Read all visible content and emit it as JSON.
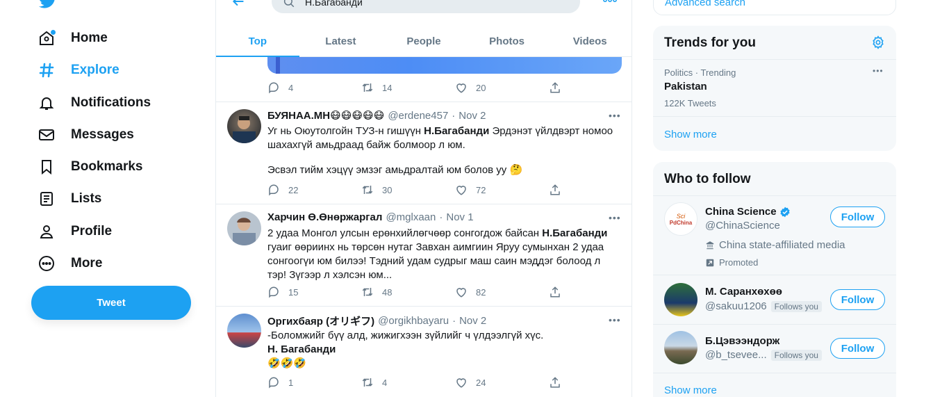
{
  "nav": {
    "items": [
      {
        "label": "Home",
        "icon": "home-icon"
      },
      {
        "label": "Explore",
        "icon": "hashtag-icon"
      },
      {
        "label": "Notifications",
        "icon": "bell-icon"
      },
      {
        "label": "Messages",
        "icon": "envelope-icon"
      },
      {
        "label": "Bookmarks",
        "icon": "bookmark-icon"
      },
      {
        "label": "Lists",
        "icon": "list-icon"
      },
      {
        "label": "Profile",
        "icon": "person-icon"
      },
      {
        "label": "More",
        "icon": "more-circle-icon"
      }
    ],
    "tweet_label": "Tweet"
  },
  "search": {
    "query": "Н.Багабанди"
  },
  "tabs": [
    "Top",
    "Latest",
    "People",
    "Photos",
    "Videos"
  ],
  "first_tweet_actions": {
    "replies": "4",
    "retweets": "14",
    "likes": "20"
  },
  "tweets": [
    {
      "name": "БУЯНАА.МН😷😷😷😷😷",
      "handle": "@erdene457",
      "date": "Nov 2",
      "text_pre": "Уг нь Оюутолгойн ТУЗ-н гишүүн ",
      "text_bold": "Н.Багабанди",
      "text_post": " Эрдэнэт үйлдвэрт номоо шахахгүй амьдраад байж болмоор л юм.",
      "text_2": "Эсвэл тийм хэцүү эмзэг амьдралтай юм болов уу 🤔",
      "replies": "22",
      "retweets": "30",
      "likes": "72"
    },
    {
      "name": "Харчин Ө.Өнөржаргал",
      "handle": "@mglxaan",
      "date": "Nov 1",
      "text_pre": "2 удаа Монгол улсын ерөнхийлөгчөөр сонгогдож байсан ",
      "text_bold": "Н.Багабанди",
      "text_post": " гуаиг өөриинх нь төрсөн нутаг Завхан аимгиин Яруу сумынхан 2 удаа сонгоогүи юм билээ! Тэдний удам судрыг маш саин мэддэг болоод л тэр! Зүгээр л хэлсэн юм...",
      "replies": "15",
      "retweets": "48",
      "likes": "82"
    },
    {
      "name": "Оргихбаяр (オリギフ)",
      "handle": "@orgikhbayaru",
      "date": "Nov 2",
      "text_line1": "-Боломжийг бүү алд, жижигхээн зүйлийг ч үлдээлгүй хүс.",
      "text_bold": "Н. Багабанди",
      "text_line3": "🤣🤣🤣",
      "replies": "1",
      "retweets": "4",
      "likes": "24"
    }
  ],
  "right": {
    "advanced_search": "Advanced search",
    "trends_title": "Trends for you",
    "trend": {
      "context": "Politics · Trending",
      "name": "Pakistan",
      "count": "122K Tweets"
    },
    "show_more": "Show more",
    "wtf_title": "Who to follow",
    "follow_label": "Follow",
    "accounts": [
      {
        "name": "China Science",
        "handle": "@ChinaScience",
        "label": "China state-affiliated media",
        "promoted": "Promoted",
        "avatar_text": "Sci",
        "avatar_text2": "PdChina"
      },
      {
        "name": "М. Саранхөхөө",
        "handle": "@sakuu1206",
        "follows_you": "Follows you"
      },
      {
        "name": "Б.Цэвээндорж",
        "handle": "@b_tsevee...",
        "follows_you": "Follows you"
      }
    ]
  },
  "colors": {
    "accent": "#1da1f2",
    "secondary_text": "#657786",
    "border": "#e6ecf0"
  }
}
